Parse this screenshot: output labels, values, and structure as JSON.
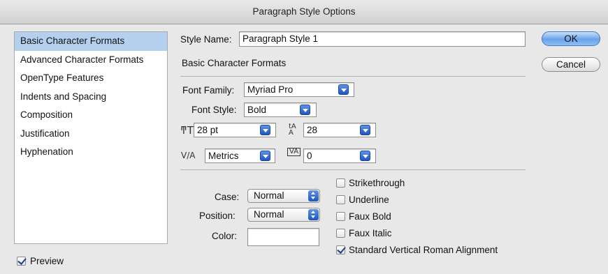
{
  "window": {
    "title": "Paragraph Style Options"
  },
  "sidebar": {
    "items": [
      {
        "label": "Basic Character Formats",
        "selected": true
      },
      {
        "label": "Advanced Character Formats"
      },
      {
        "label": "OpenType Features"
      },
      {
        "label": "Indents and Spacing"
      },
      {
        "label": "Composition"
      },
      {
        "label": "Justification"
      },
      {
        "label": "Hyphenation"
      }
    ],
    "selected_color": "#b5d0ee"
  },
  "preview": {
    "label": "Preview",
    "checked": true
  },
  "style_name": {
    "label": "Style Name:",
    "value": "Paragraph Style 1"
  },
  "section_title": "Basic Character Formats",
  "font_family": {
    "label": "Font Family:",
    "value": "Myriad Pro"
  },
  "font_style": {
    "label": "Font Style:",
    "value": "Bold"
  },
  "font_size": {
    "icon": "font-size-icon",
    "value": "28 pt"
  },
  "leading": {
    "icon": "leading-icon",
    "value": "28"
  },
  "kerning": {
    "icon": "kerning-icon",
    "value": "Metrics"
  },
  "tracking": {
    "icon": "tracking-icon",
    "value": "0"
  },
  "case": {
    "label": "Case:",
    "value": "Normal"
  },
  "position": {
    "label": "Position:",
    "value": "Normal"
  },
  "color": {
    "label": "Color:",
    "value": ""
  },
  "checkboxes": [
    {
      "label": "Strikethrough",
      "checked": false
    },
    {
      "label": "Underline",
      "checked": false
    },
    {
      "label": "Faux Bold",
      "checked": false
    },
    {
      "label": "Faux Italic",
      "checked": false
    },
    {
      "label": "Standard Vertical Roman Alignment",
      "checked": true
    }
  ],
  "buttons": {
    "ok": "OK",
    "cancel": "Cancel"
  },
  "accent_color": "#1e56c2"
}
